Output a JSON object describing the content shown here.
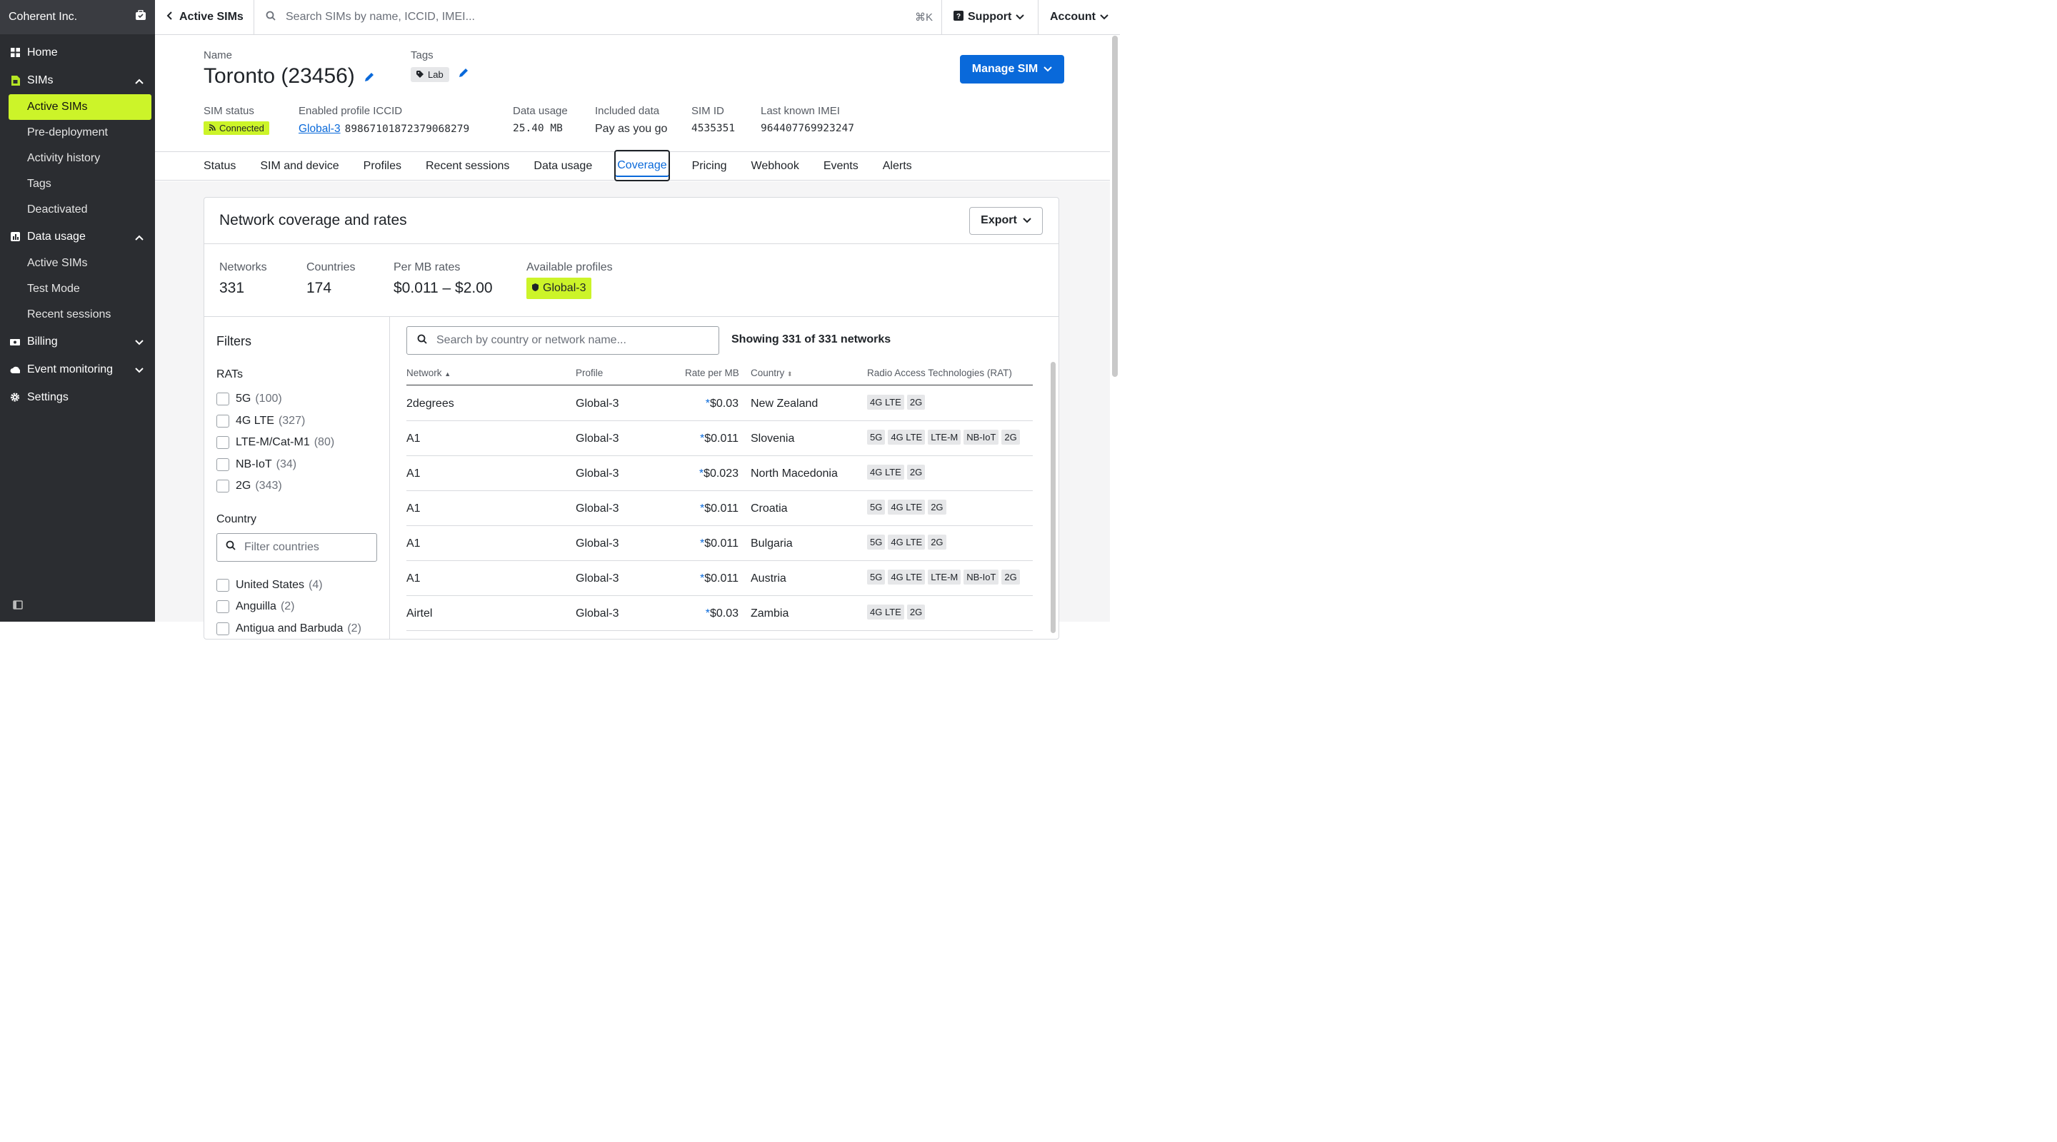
{
  "org": {
    "name": "Coherent Inc."
  },
  "nav": {
    "home": "Home",
    "sims": "SIMs",
    "sims_items": [
      "Active SIMs",
      "Pre-deployment",
      "Activity history",
      "Tags",
      "Deactivated"
    ],
    "data_usage": "Data usage",
    "data_usage_items": [
      "Active SIMs",
      "Test Mode",
      "Recent sessions"
    ],
    "billing": "Billing",
    "event_monitoring": "Event monitoring",
    "settings": "Settings"
  },
  "topbar": {
    "back_label": "Active SIMs",
    "search_placeholder": "Search SIMs by name, ICCID, IMEI...",
    "shortcut": "⌘K",
    "support": "Support",
    "account": "Account"
  },
  "sim": {
    "name_label": "Name",
    "name": "Toronto (23456)",
    "tags_label": "Tags",
    "tag": "Lab",
    "manage_label": "Manage SIM",
    "status_label": "SIM status",
    "status": "Connected",
    "iccid_label": "Enabled profile ICCID",
    "iccid_profile": "Global-3",
    "iccid": "89867101872379068279",
    "data_usage_label": "Data usage",
    "data_usage": "25.40 MB",
    "included_label": "Included data",
    "included": "Pay as you go",
    "simid_label": "SIM ID",
    "simid": "4535351",
    "imei_label": "Last known IMEI",
    "imei": "964407769923247"
  },
  "tabs": [
    "Status",
    "SIM and device",
    "Profiles",
    "Recent sessions",
    "Data usage",
    "Coverage",
    "Pricing",
    "Webhook",
    "Events",
    "Alerts"
  ],
  "coverage": {
    "title": "Network coverage and rates",
    "export_label": "Export",
    "networks_label": "Networks",
    "networks": "331",
    "countries_label": "Countries",
    "countries": "174",
    "rates_label": "Per MB rates",
    "rates": "$0.011 – $2.00",
    "profiles_label": "Available profiles",
    "profile": "Global-3"
  },
  "filters": {
    "title": "Filters",
    "rats_label": "RATs",
    "rats": [
      {
        "label": "5G",
        "count": "(100)"
      },
      {
        "label": "4G LTE",
        "count": "(327)"
      },
      {
        "label": "LTE-M/Cat-M1",
        "count": "(80)"
      },
      {
        "label": "NB-IoT",
        "count": "(34)"
      },
      {
        "label": "2G",
        "count": "(343)"
      }
    ],
    "country_label": "Country",
    "country_placeholder": "Filter countries",
    "countries": [
      {
        "label": "United States",
        "count": "(4)"
      },
      {
        "label": "Anguilla",
        "count": "(2)"
      },
      {
        "label": "Antigua and Barbuda",
        "count": "(2)"
      }
    ]
  },
  "table": {
    "search_placeholder": "Search by country or network name...",
    "showing": "Showing 331 of 331 networks",
    "headers": {
      "network": "Network",
      "profile": "Profile",
      "rate": "Rate per MB",
      "country": "Country",
      "rat": "Radio Access Technologies (RAT)"
    },
    "rows": [
      {
        "network": "2degrees",
        "profile": "Global-3",
        "star": "*",
        "rate": "$0.03",
        "country": "New Zealand",
        "rats": [
          "4G LTE",
          "2G"
        ]
      },
      {
        "network": "A1",
        "profile": "Global-3",
        "star": "*",
        "rate": "$0.011",
        "country": "Slovenia",
        "rats": [
          "5G",
          "4G LTE",
          "LTE-M",
          "NB-IoT",
          "2G"
        ]
      },
      {
        "network": "A1",
        "profile": "Global-3",
        "star": "*",
        "rate": "$0.023",
        "country": "North Macedonia",
        "rats": [
          "4G LTE",
          "2G"
        ]
      },
      {
        "network": "A1",
        "profile": "Global-3",
        "star": "*",
        "rate": "$0.011",
        "country": "Croatia",
        "rats": [
          "5G",
          "4G LTE",
          "2G"
        ]
      },
      {
        "network": "A1",
        "profile": "Global-3",
        "star": "*",
        "rate": "$0.011",
        "country": "Bulgaria",
        "rats": [
          "5G",
          "4G LTE",
          "2G"
        ]
      },
      {
        "network": "A1",
        "profile": "Global-3",
        "star": "*",
        "rate": "$0.011",
        "country": "Austria",
        "rats": [
          "5G",
          "4G LTE",
          "LTE-M",
          "NB-IoT",
          "2G"
        ]
      },
      {
        "network": "Airtel",
        "profile": "Global-3",
        "star": "*",
        "rate": "$0.03",
        "country": "Zambia",
        "rats": [
          "4G LTE",
          "2G"
        ]
      }
    ]
  },
  "colors": {
    "accent": "#ccf429",
    "link": "#0969da",
    "sidebar": "#2b2d31"
  }
}
